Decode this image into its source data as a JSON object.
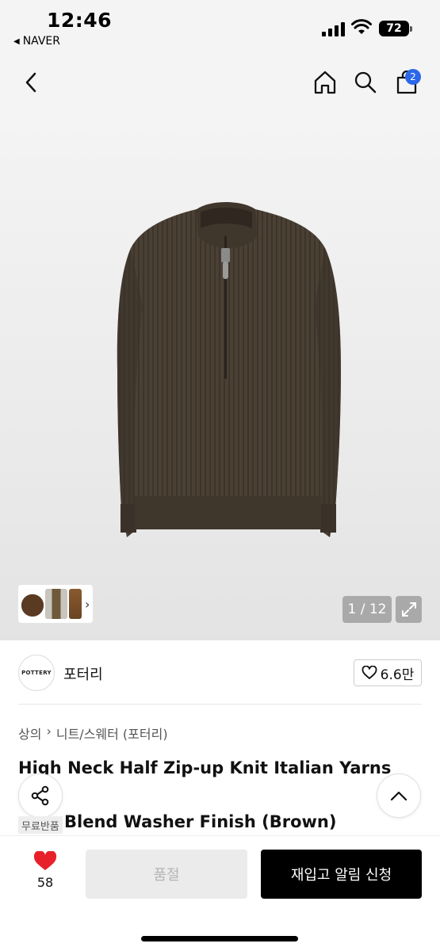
{
  "status_bar": {
    "time": "12:46",
    "back_app": "NAVER",
    "battery": "72"
  },
  "header": {
    "cart_count": "2",
    "icons": [
      "back-icon",
      "home-icon",
      "search-icon",
      "cart-icon"
    ]
  },
  "gallery": {
    "counter": "1 / 12",
    "product_color": "#4a4034"
  },
  "brand": {
    "logo_text": "POTTERY",
    "name": "포터리",
    "likes": "6.6만"
  },
  "product": {
    "breadcrumb": [
      "상의",
      "니트/스웨터 (포터리)"
    ],
    "title_line1": "High Neck Half Zip-up Knit Italian Yarns Silk",
    "title_line2": "Blend Washer Finish (Brown)",
    "badge": "무료반품"
  },
  "bottom_bar": {
    "wish_count": "58",
    "soldout_label": "품절",
    "restock_label": "재입고 알림 신청",
    "heart_color": "#e8202a"
  }
}
